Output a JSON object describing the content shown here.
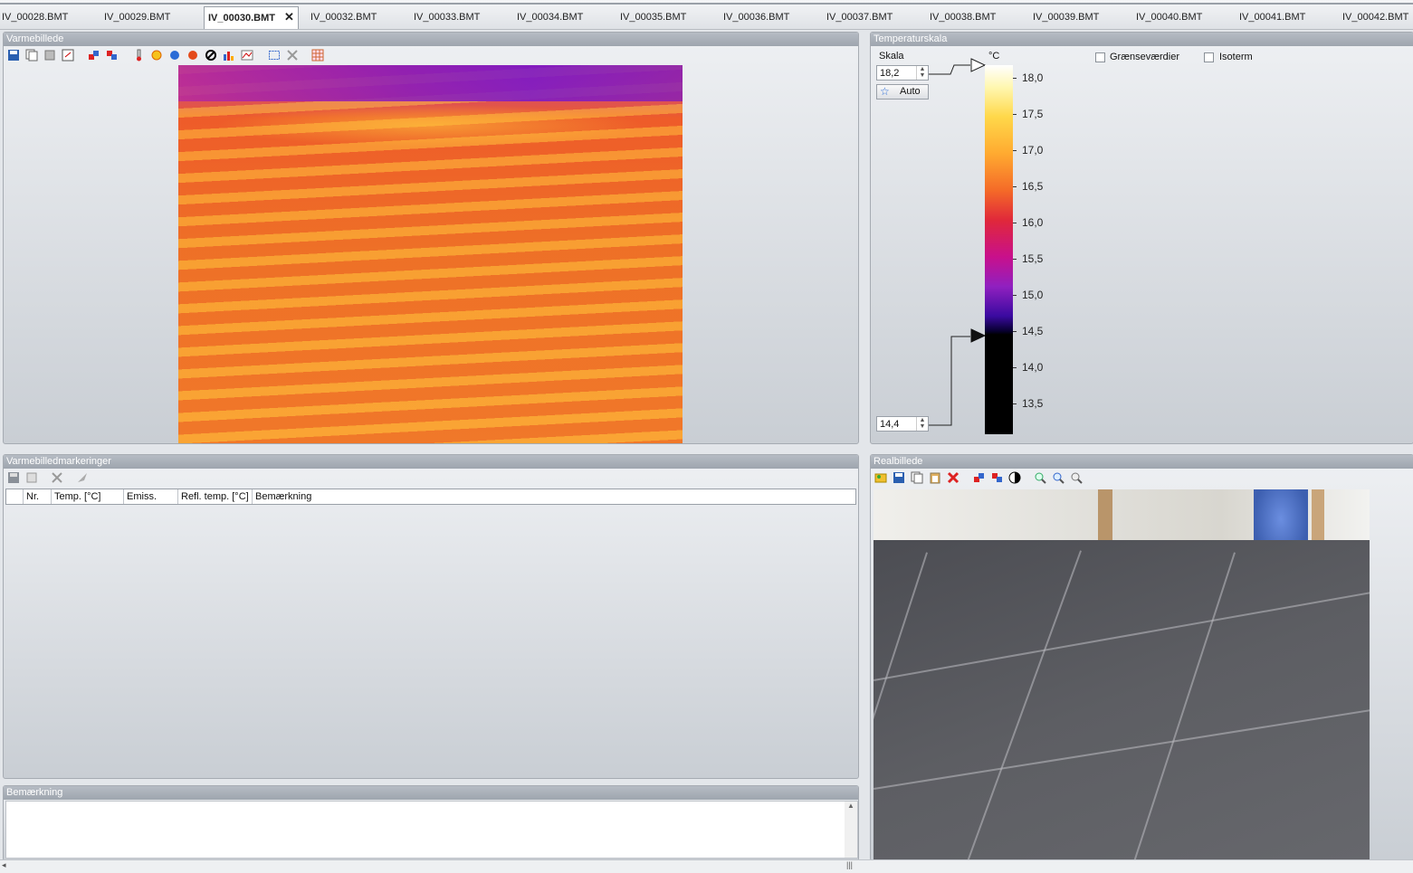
{
  "tabs": [
    {
      "label": "IV_00028.BMT",
      "active": false
    },
    {
      "label": "IV_00029.BMT",
      "active": false
    },
    {
      "label": "IV_00030.BMT",
      "active": true
    },
    {
      "label": "IV_00032.BMT",
      "active": false
    },
    {
      "label": "IV_00033.BMT",
      "active": false
    },
    {
      "label": "IV_00034.BMT",
      "active": false
    },
    {
      "label": "IV_00035.BMT",
      "active": false
    },
    {
      "label": "IV_00036.BMT",
      "active": false
    },
    {
      "label": "IV_00037.BMT",
      "active": false
    },
    {
      "label": "IV_00038.BMT",
      "active": false
    },
    {
      "label": "IV_00039.BMT",
      "active": false
    },
    {
      "label": "IV_00040.BMT",
      "active": false
    },
    {
      "label": "IV_00041.BMT",
      "active": false
    },
    {
      "label": "IV_00042.BMT",
      "active": false
    }
  ],
  "tab_close": "✕",
  "panels": {
    "thermal": {
      "title": "Varmebillede"
    },
    "scale": {
      "title": "Temperaturskala",
      "skala_label": "Skala",
      "max_value": "18,2",
      "min_value": "14,4",
      "auto_label": "Auto",
      "unit": "°C",
      "limits_label": "Grænseværdier",
      "isotherm_label": "Isoterm",
      "ticks": [
        "18,0",
        "17,5",
        "17,0",
        "16,5",
        "16,0",
        "15,5",
        "15,0",
        "14,5",
        "14,0",
        "13,5"
      ]
    },
    "markings": {
      "title": "Varmebilledmarkeringer",
      "columns": [
        "Nr.",
        "Temp. [°C]",
        "Emiss.",
        "Refl. temp. [°C]",
        "Bemærkning"
      ]
    },
    "remark": {
      "title": "Bemærkning",
      "text": ""
    },
    "real": {
      "title": "Realbillede"
    }
  },
  "colors": {
    "panel_title_bg": "#9ea5ae",
    "panel_bg": "#c9ced4"
  }
}
